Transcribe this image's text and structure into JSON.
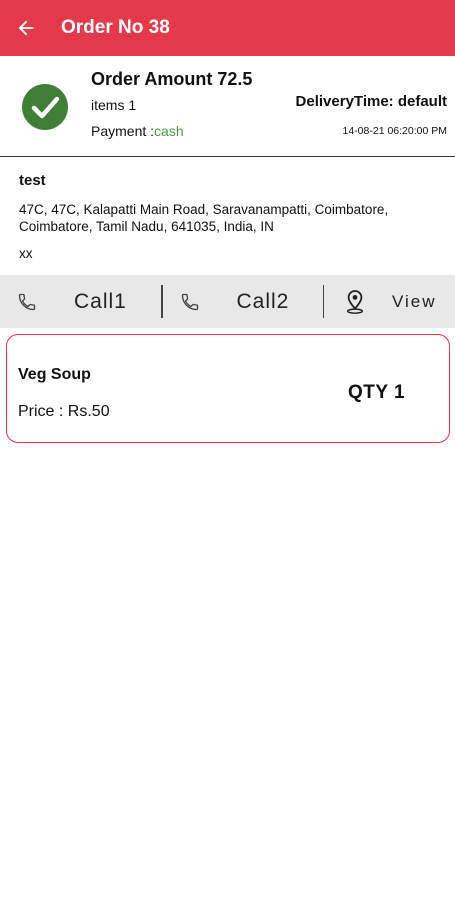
{
  "app_bar": {
    "title": "Order No 38",
    "background_color": "#e23a4a",
    "back_icon": "arrow-left-icon"
  },
  "summary": {
    "status_icon": "check-circle-icon",
    "status_color": "#3f7f35",
    "order_amount": "Order Amount 72.5",
    "items": "items 1",
    "payment_label": "Payment :",
    "payment_value": "cash",
    "payment_color": "#43a047",
    "delivery_time": "DeliveryTime: default",
    "datetime": "14-08-21 06:20:00 PM"
  },
  "customer": {
    "name": "test",
    "address": "47C, 47C, Kalapatti Main Road, Saravanampatti, Coimbatore, Coimbatore, Tamil Nadu, 641035, India, IN",
    "note": "xx"
  },
  "actions": {
    "call1_label": "Call1",
    "call2_label": "Call2",
    "view_label": "View",
    "call_icon": "phone-icon",
    "view_icon": "map-pin-icon"
  },
  "items": [
    {
      "name": "Veg Soup",
      "price": "Price : Rs.50",
      "qty": "QTY  1"
    }
  ]
}
